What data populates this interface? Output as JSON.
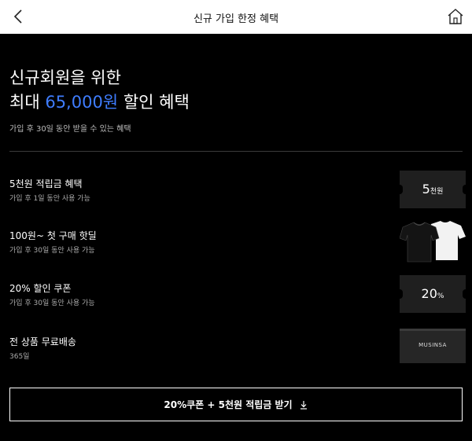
{
  "header": {
    "title": "신규 가입 한정 혜택"
  },
  "hero": {
    "line1": "신규회원을 위한",
    "line2_prefix": "최대 ",
    "amount": "65,000원",
    "line2_suffix": " 할인 혜택",
    "subtitle": "가입 후 30일 동안 받을 수 있는 혜택"
  },
  "benefits": [
    {
      "title": "5천원 적립금 혜택",
      "desc": "가입 후 1일 동안 사용 가능",
      "badge_value": "5",
      "badge_unit": "천원"
    },
    {
      "title": "100원~ 첫 구매 핫딜",
      "desc": "가입 후 30일 동안 사용 가능"
    },
    {
      "title": "20% 할인 쿠폰",
      "desc": "가입 후 30일 동안 사용 가능",
      "badge_value": "20",
      "badge_unit": "%"
    },
    {
      "title": "전 상품 무료배송",
      "desc": "365일",
      "box_logo": "MUSINSA"
    }
  ],
  "cta": {
    "label": "20%쿠폰 + 5천원 적립금 받기"
  },
  "colors": {
    "accent": "#3f7dff",
    "background": "#000000"
  }
}
